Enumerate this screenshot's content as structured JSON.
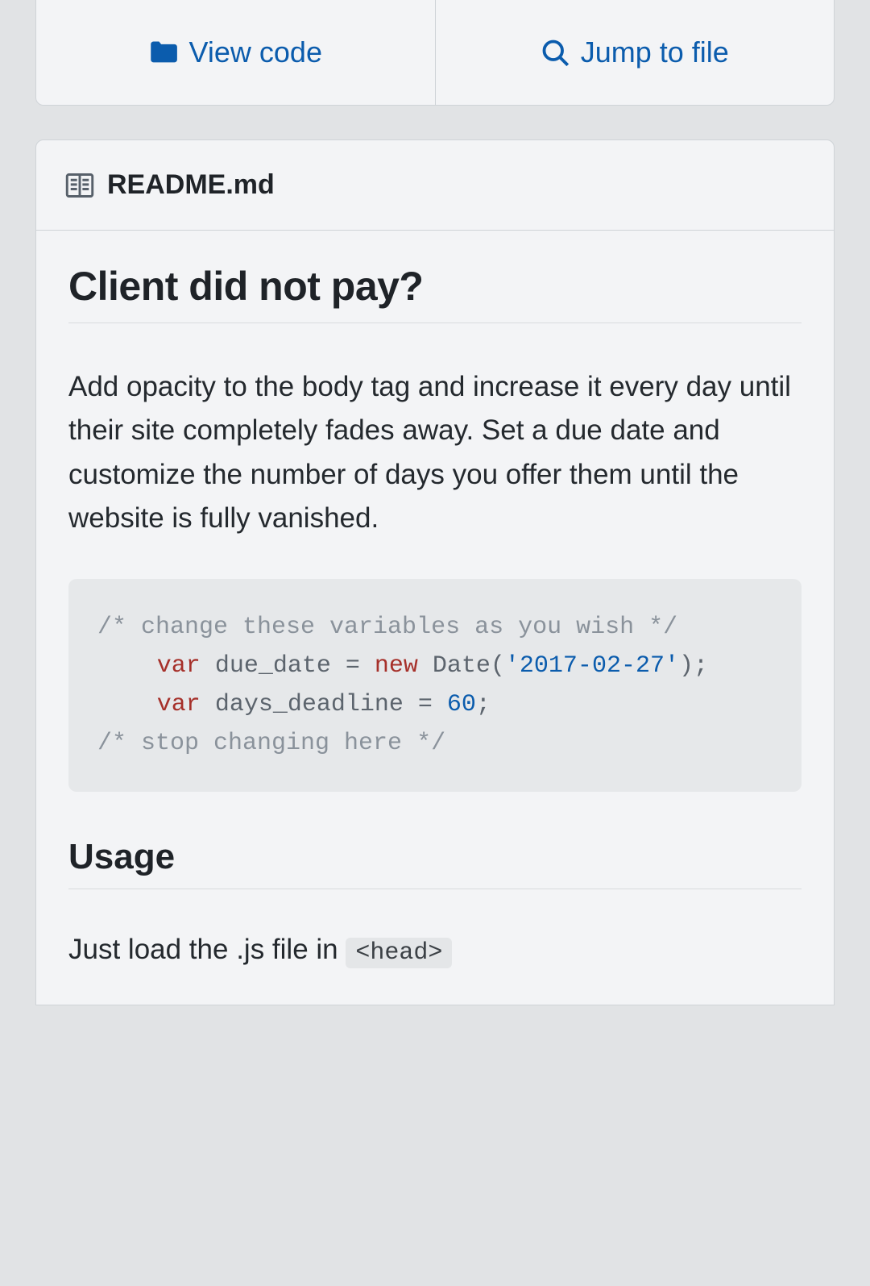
{
  "toolbar": {
    "view_code_label": "View code",
    "jump_to_file_label": "Jump to file"
  },
  "readme": {
    "filename": "README.md",
    "heading1": "Client did not pay?",
    "paragraph1": "Add opacity to the body tag and increase it every day until their site completely fades away. Set a due date and customize the number of days you offer them until the website is fully vanished.",
    "code": {
      "comment_open": "/* change these variables as you wish */",
      "var1_keyword": "var",
      "var1_name": "due_date",
      "var1_eq": " = ",
      "var1_new": "new",
      "var1_call_a": "Date(",
      "var1_string": "'2017-02-27'",
      "var1_call_b": ");",
      "var2_keyword": "var",
      "var2_name": "days_deadline",
      "var2_eq": " = ",
      "var2_value": "60",
      "var2_semi": ";",
      "comment_close": "/* stop changing here */"
    },
    "heading2": "Usage",
    "paragraph2_prefix": "Just load the .js file in ",
    "paragraph2_code": "<head>"
  }
}
